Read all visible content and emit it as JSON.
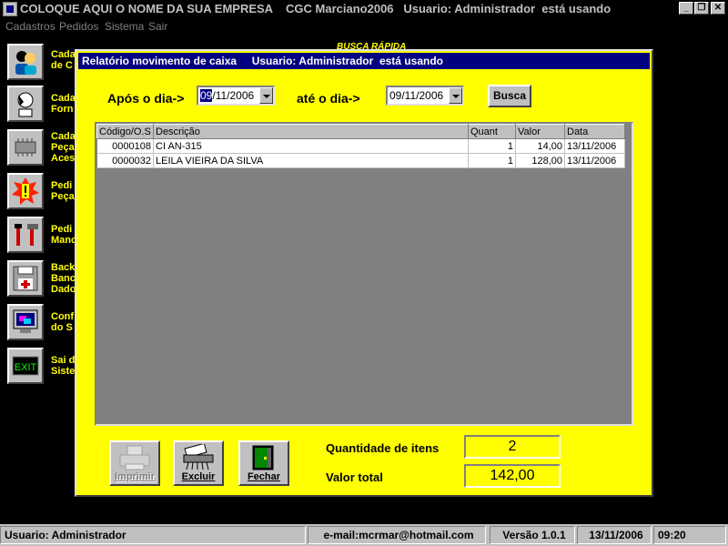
{
  "window": {
    "title": "COLOQUE AQUI O NOME DA SUA EMPRESA    CGC Marciano2006   Usuario: Administrador  está usando"
  },
  "menu": [
    "Cadastros",
    "Pedidos",
    "Sistema",
    "Sair"
  ],
  "sidebar": [
    {
      "icon": "people-icon",
      "label": "Cada\nde C"
    },
    {
      "icon": "phone-person-icon",
      "label": "Cada\nForn"
    },
    {
      "icon": "chip-icon",
      "label": "Cada\nPeça\nAces"
    },
    {
      "icon": "alert-icon",
      "label": "Pedi\nPeça"
    },
    {
      "icon": "tools-icon",
      "label": "Pedi\nMano"
    },
    {
      "icon": "floppy-icon",
      "label": "Back\nBanc\nDado"
    },
    {
      "icon": "monitor-icon",
      "label": "Conf\ndo S"
    },
    {
      "icon": "exit-icon",
      "label": "Sai d\nSiste"
    }
  ],
  "busca_rapida": "BUSCA RÁPIDA",
  "dialog": {
    "title": "Relatório movimento de caixa     Usuario: Administrador  está usando",
    "after_label": "Após o dia->",
    "after_date_sel": "09",
    "after_date_rest": "/11/2006",
    "until_label": "até o dia->",
    "until_date": "09/11/2006",
    "search_button": "Busca",
    "columns": [
      "Código/O.S",
      "Descrição",
      "Quant",
      "Valor",
      "Data"
    ],
    "rows": [
      [
        "0000108",
        "CI AN-315",
        "1",
        "14,00",
        "13/11/2006"
      ],
      [
        "0000032",
        "LEILA VIEIRA DA SILVA",
        "1",
        "128,00",
        "13/11/2006"
      ]
    ],
    "print_button": "Imprimir",
    "delete_button": "Excluir",
    "close_button": "Fechar",
    "qty_label": "Quantidade de itens",
    "qty_value": "2",
    "total_label": "Valor total",
    "total_value": "142,00"
  },
  "status": {
    "user": "Usuario: Administrador",
    "email": "e-mail:mcrmar@hotmail.com",
    "version": "Versão 1.0.1",
    "date": "13/11/2006",
    "time": "09:20"
  }
}
